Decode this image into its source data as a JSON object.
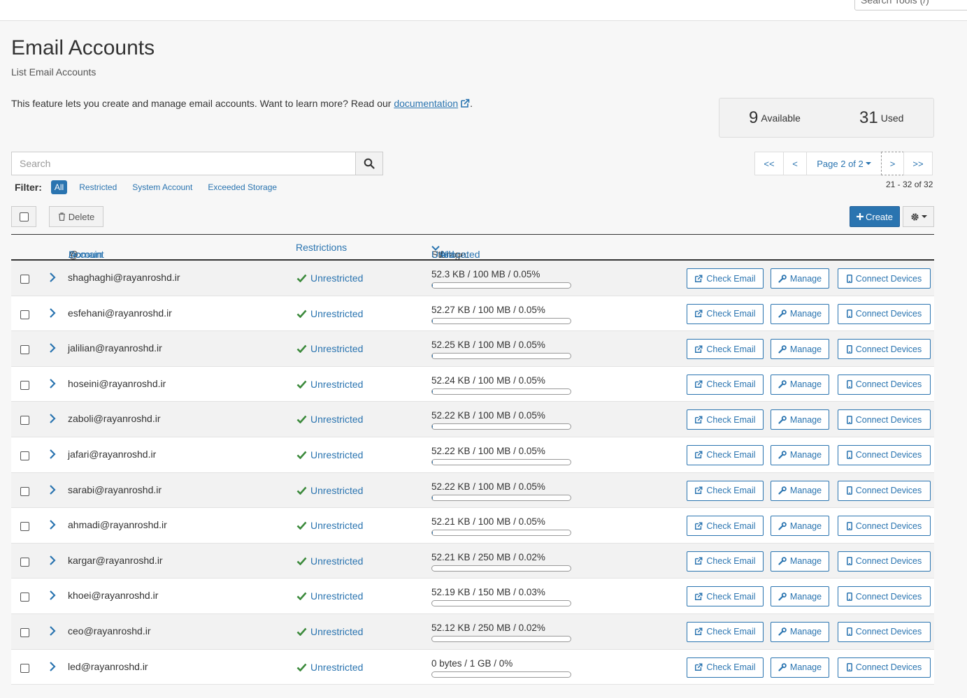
{
  "topbar": {
    "search_tools_placeholder": "Search Tools (/)"
  },
  "page": {
    "title": "Email Accounts",
    "subtitle": "List Email Accounts",
    "intro_text": "This feature lets you create and manage email accounts. Want to learn more? Read our ",
    "intro_link": "documentation",
    "intro_end": "."
  },
  "stats": {
    "available_num": "9",
    "available_label": "Available",
    "used_num": "31",
    "used_label": "Used"
  },
  "search": {
    "placeholder": "Search"
  },
  "filter": {
    "label": "Filter:",
    "options": [
      "All",
      "Restricted",
      "System Account",
      "Exceeded Storage"
    ]
  },
  "pager": {
    "first": "<<",
    "prev": "<",
    "page_label": "Page 2 of 2",
    "next": ">",
    "last": ">>",
    "range": "21 - 32 of 32"
  },
  "toolbar": {
    "delete_label": "Delete",
    "create_label": "Create"
  },
  "table": {
    "headers": {
      "account": "Account",
      "at": "@",
      "domain": "Domain",
      "restrictions": "Restrictions",
      "storage_prefix": "Storage:",
      "used": "Used",
      "slash1": "/",
      "allocated": "Allocated",
      "slash2": "/",
      "percent": "%"
    },
    "action_labels": {
      "check": "Check Email",
      "manage": "Manage",
      "connect": "Connect Devices"
    },
    "rows": [
      {
        "account": "shaghaghi@rayanroshd.ir",
        "restriction": "Unrestricted",
        "storage": "52.3 KB / 100 MB / 0.05%",
        "usage_fraction": 0.0005
      },
      {
        "account": "esfehani@rayanroshd.ir",
        "restriction": "Unrestricted",
        "storage": "52.27 KB / 100 MB / 0.05%",
        "usage_fraction": 0.0005
      },
      {
        "account": "jalilian@rayanroshd.ir",
        "restriction": "Unrestricted",
        "storage": "52.25 KB / 100 MB / 0.05%",
        "usage_fraction": 0.0005
      },
      {
        "account": "hoseini@rayanroshd.ir",
        "restriction": "Unrestricted",
        "storage": "52.24 KB / 100 MB / 0.05%",
        "usage_fraction": 0.0005
      },
      {
        "account": "zaboli@rayanroshd.ir",
        "restriction": "Unrestricted",
        "storage": "52.22 KB / 100 MB / 0.05%",
        "usage_fraction": 0.0005
      },
      {
        "account": "jafari@rayanroshd.ir",
        "restriction": "Unrestricted",
        "storage": "52.22 KB / 100 MB / 0.05%",
        "usage_fraction": 0.0005
      },
      {
        "account": "sarabi@rayanroshd.ir",
        "restriction": "Unrestricted",
        "storage": "52.22 KB / 100 MB / 0.05%",
        "usage_fraction": 0.0005
      },
      {
        "account": "ahmadi@rayanroshd.ir",
        "restriction": "Unrestricted",
        "storage": "52.21 KB / 100 MB / 0.05%",
        "usage_fraction": 0.0005
      },
      {
        "account": "kargar@rayanroshd.ir",
        "restriction": "Unrestricted",
        "storage": "52.21 KB / 250 MB / 0.02%",
        "usage_fraction": 0.0002
      },
      {
        "account": "khoei@rayanroshd.ir",
        "restriction": "Unrestricted",
        "storage": "52.19 KB / 150 MB / 0.03%",
        "usage_fraction": 0.0003
      },
      {
        "account": "ceo@rayanroshd.ir",
        "restriction": "Unrestricted",
        "storage": "52.12 KB / 250 MB / 0.02%",
        "usage_fraction": 0.0002
      },
      {
        "account": "led@rayanroshd.ir",
        "restriction": "Unrestricted",
        "storage": "0 bytes / 1 GB / 0%",
        "usage_fraction": 0
      }
    ]
  },
  "colors": {
    "accent": "#2a74b0",
    "check_green": "#3c8a3c"
  }
}
